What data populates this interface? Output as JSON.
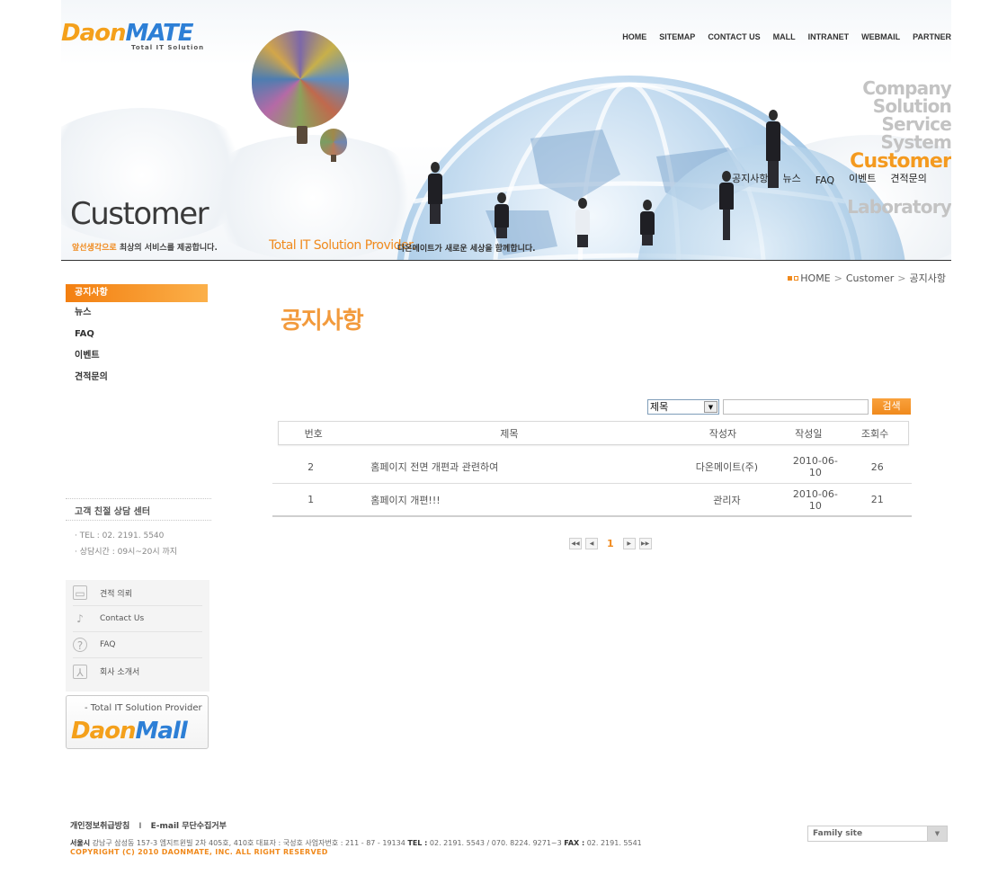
{
  "logo": {
    "main_d": "Daon",
    "main_m": "MATE",
    "sub": "Total IT Solution"
  },
  "topnav": [
    "HOME",
    "SITEMAP",
    "CONTACT US",
    "MALL",
    "INTRANET",
    "WEBMAIL",
    "PARTNER"
  ],
  "header": {
    "title": "Customer",
    "slogan_highlight": "앞선생각으로",
    "slogan_rest": " 최상의 서비스를 제공합니다.",
    "provider": "Total IT Solution Provider.",
    "provider_desc": "다온메이트가 새로운 세상을 함께합니다."
  },
  "bigmenu": {
    "items": [
      "Company",
      "Solution",
      "Service",
      "System",
      "Customer"
    ],
    "active": "Customer",
    "last": "Laboratory",
    "submenu": [
      "공지사항",
      "뉴스",
      "FAQ",
      "이벤트",
      "견적문의"
    ]
  },
  "breadcrumb": {
    "home": "HOME",
    "section": "Customer",
    "current": "공지사항"
  },
  "sidebar": {
    "active": "공지사항",
    "items": [
      "뉴스",
      "FAQ",
      "이벤트",
      "견적문의"
    ]
  },
  "counsel": {
    "title": "고객 친절 상담 센터",
    "tel": "· TEL : 02. 2191. 5540",
    "hours": "· 상담시간 : 09시~20시 까지"
  },
  "quick_links": [
    {
      "icon": "folder-icon",
      "label": "견적 의뢰"
    },
    {
      "icon": "microphone-icon",
      "label": "Contact Us"
    },
    {
      "icon": "question-icon",
      "label": "FAQ"
    },
    {
      "icon": "pdf-icon",
      "label": "회사 소개서"
    }
  ],
  "mall_banner": {
    "tag": "- Total IT Solution Provider",
    "logo_d": "Daon",
    "logo_m": "Mall"
  },
  "page_title": "공지사항",
  "search": {
    "select_value": "제목",
    "button": "검색",
    "input_value": ""
  },
  "board": {
    "headers": {
      "no": "번호",
      "title": "제목",
      "writer": "작성자",
      "date": "작성일",
      "views": "조회수"
    },
    "rows": [
      {
        "no": "2",
        "title": "홈페이지 전면 개편과 관련하여",
        "writer": "다온메이트(주)",
        "date": "2010-06-10",
        "views": "26"
      },
      {
        "no": "1",
        "title": "홈페이지 개편!!!",
        "writer": "관리자",
        "date": "2010-06-10",
        "views": "21"
      }
    ]
  },
  "paging": {
    "current": "1"
  },
  "footer": {
    "link1": "개인정보취급방침",
    "link_sep": "I",
    "link2": "E-mail 무단수집거부",
    "addr_label": "서울시",
    "addr": " 강남구 삼성동 157-3 엠지트윈빌 2차 405호, 410호     대표자 : 국성호    사업자번호 : 211 - 87 - 19134   ",
    "tel_label": "TEL :",
    "tel": " 02. 2191. 5543  /  070. 8224. 9271~3   ",
    "fax_label": "FAX :",
    "fax": " 02. 2191. 5541",
    "copyright": "COPYRIGHT (C) 2010 DAONMATE, INC. ALL RIGHT RESERVED",
    "family_site": "Family site"
  },
  "colors": {
    "accent": "#f08a1d",
    "title": "#f29a3c",
    "logo_blue": "#2d7fd6",
    "logo_orange": "#f4a01b"
  }
}
